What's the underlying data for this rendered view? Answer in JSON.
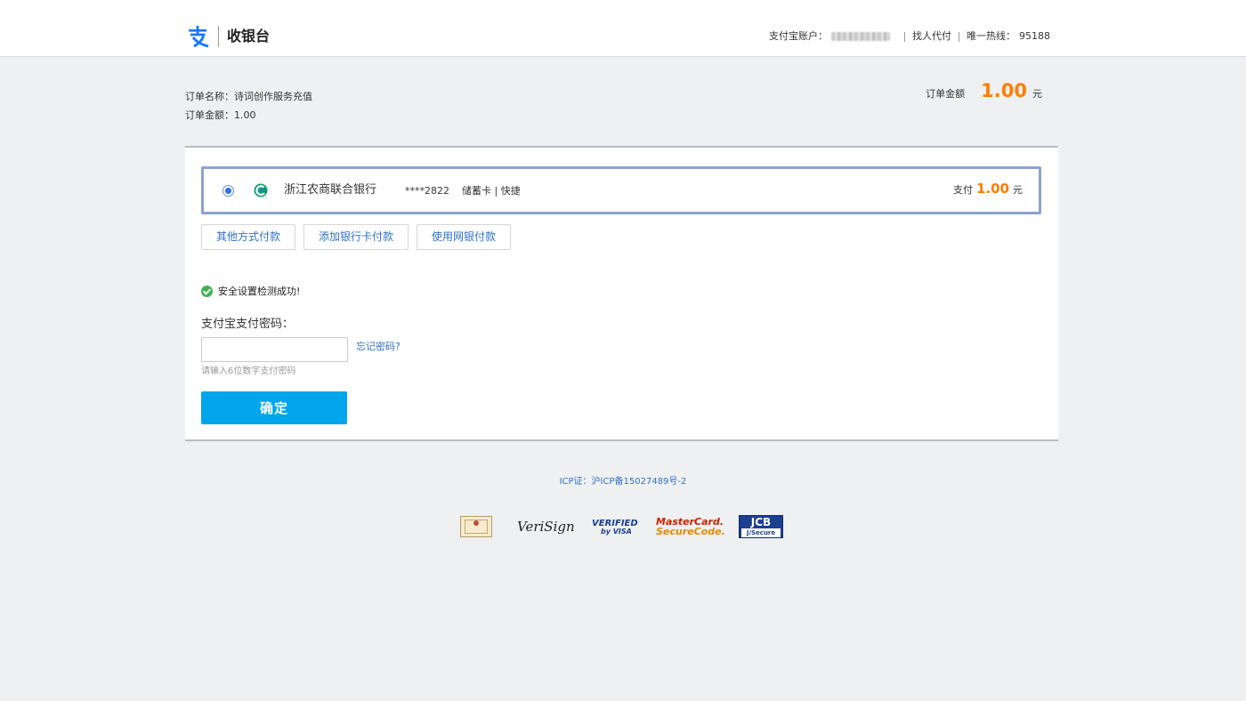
{
  "header": {
    "brand_title": "收银台",
    "account_label": "支付宝账户：",
    "find_pay_link": "找人代付",
    "hotline_label": "唯一热线：",
    "hotline_number": "95188"
  },
  "order": {
    "name_label": "订单名称：",
    "name_value": "诗词创作服务充值",
    "amount_label": "订单金额：",
    "amount_value": "1.00",
    "summary_label": "订单金额",
    "summary_amount": "1.00",
    "summary_unit": "元"
  },
  "payment_option": {
    "bank_name": "浙江农商联合银行",
    "card_number": "****2822",
    "card_type": "储蓄卡 | 快捷",
    "pay_label": "支付",
    "pay_amount": "1.00",
    "pay_unit": "元"
  },
  "alt_buttons": {
    "other_method": "其他方式付款",
    "add_card": "添加银行卡付款",
    "net_bank": "使用网银付款"
  },
  "security": {
    "message": "安全设置检测成功!"
  },
  "password": {
    "label": "支付宝支付密码：",
    "value": "",
    "forgot_link": "忘记密码?",
    "hint": "请输入6位数字支付密码"
  },
  "confirm_button": "确定",
  "footer": {
    "icp": "ICP证：沪ICP备15027489号-2",
    "badges": {
      "verisign": "VeriSign",
      "visa_top": "VERIFIED",
      "visa_bottom": "by VISA",
      "mastercard_top": "MasterCard.",
      "mastercard_bottom": "SecureCode.",
      "jcb_top": "JCB",
      "jcb_bottom": "J/Secure"
    }
  },
  "colors": {
    "accent_orange": "#ff7d00",
    "link_blue": "#2e70c8",
    "confirm_blue": "#00a5eb",
    "selected_border": "#8ca1d3",
    "success_green": "#3fb34f"
  },
  "icons": {
    "logo": "alipay-logo-icon",
    "bank": "bank-logo-icon",
    "check": "check-circle-icon"
  }
}
